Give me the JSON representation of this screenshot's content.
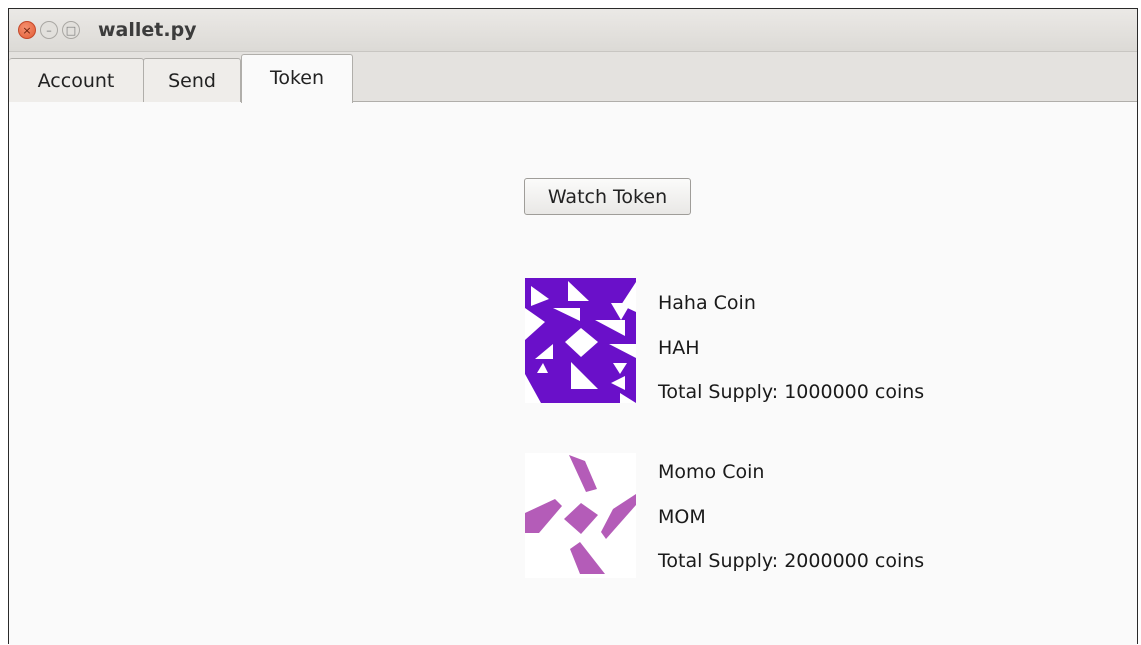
{
  "window": {
    "title": "wallet.py"
  },
  "window_controls": {
    "close": "×",
    "minimize": "–",
    "maximize": "□"
  },
  "tabs": [
    {
      "label": "Account"
    },
    {
      "label": "Send"
    },
    {
      "label": "Token",
      "active": true
    }
  ],
  "token_page": {
    "watch_button_label": "Watch Token",
    "tokens": [
      {
        "name": "Haha Coin",
        "symbol": "HAH",
        "supply": "Total Supply: 1000000 coins",
        "icon": "identicon-purple",
        "color": "#6a10c9"
      },
      {
        "name": "Momo Coin",
        "symbol": "MOM",
        "supply": "Total Supply: 2000000 coins",
        "icon": "identicon-violet",
        "color": "#b45cb8"
      }
    ]
  }
}
